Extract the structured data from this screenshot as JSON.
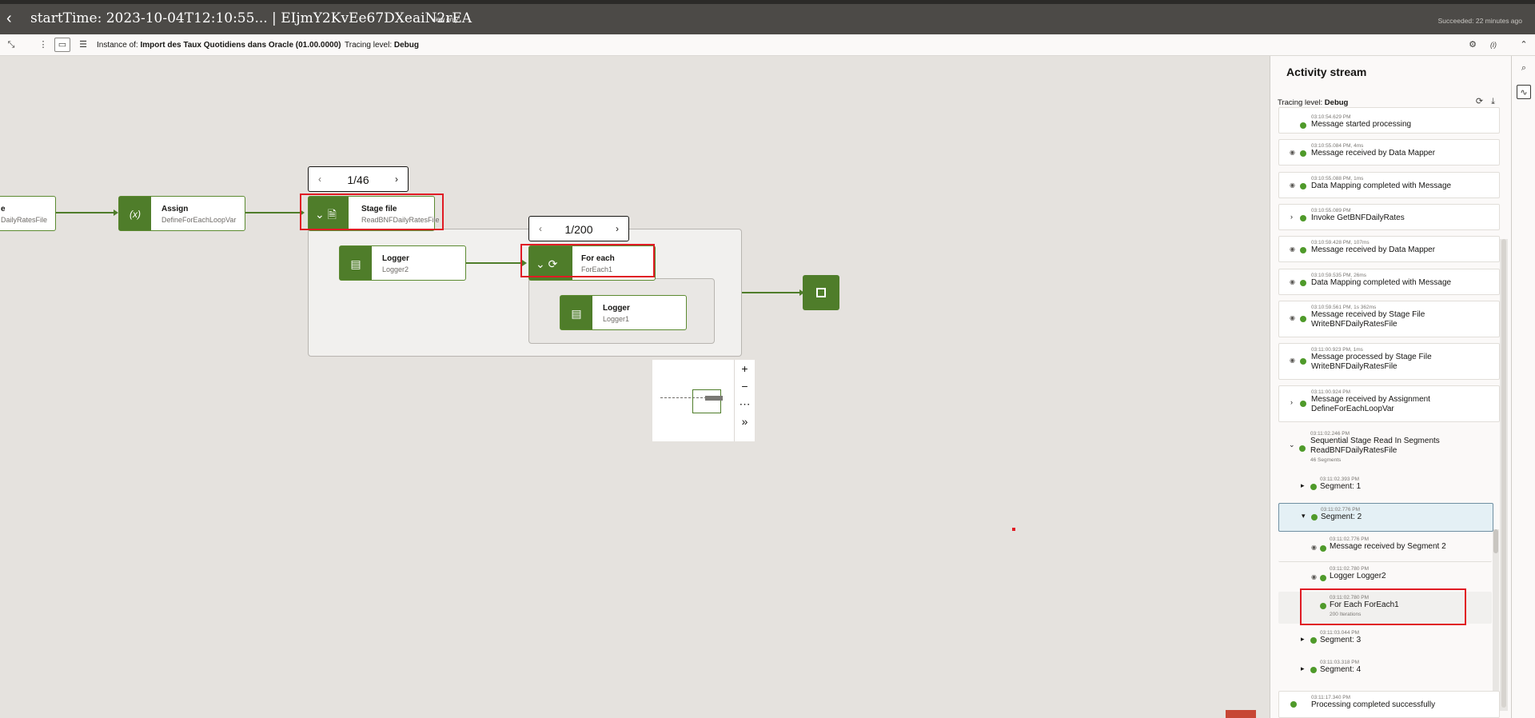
{
  "header": {
    "title": "startTime: 2023-10-04T12:10:55... | EIjmY2KvEe67DXeaiN2rEA",
    "view_only": "View only",
    "status": "Succeeded: 22 minutes ago"
  },
  "toolbar": {
    "instance_label": "Instance of:",
    "instance_name": "Import des Taux Quotidiens dans Oracle (01.00.0000)",
    "tracing_label": "Tracing level:",
    "tracing_value": "Debug",
    "help_glyph": "(i)"
  },
  "canvas": {
    "nodes": {
      "partial": {
        "name": "e",
        "sub": "DailyRatesFile"
      },
      "assign": {
        "name": "Assign",
        "sub": "DefineForEachLoopVar",
        "icon_glyph": "(x)"
      },
      "stage": {
        "name": "Stage file",
        "sub": "ReadBNFDailyRatesFile"
      },
      "logger2": {
        "name": "Logger",
        "sub": "Logger2"
      },
      "foreach": {
        "name": "For each",
        "sub": "ForEach1"
      },
      "logger1": {
        "name": "Logger",
        "sub": "Logger1"
      }
    },
    "pager_stage": "1/46",
    "pager_foreach": "1/200",
    "pager_prev": "‹",
    "pager_next": "›"
  },
  "icons": {
    "back": "back-arrow-icon",
    "collapse": "collapse-icon",
    "settings": "gear-icon",
    "search": "search-icon",
    "activity": "activity-icon",
    "refresh": "refresh-icon",
    "download": "download-icon"
  },
  "colors": {
    "accent_green": "#4f7d2a",
    "header_bg": "#4c4a47",
    "highlight_red": "#e01b24",
    "success": "#4f9a2a"
  },
  "activity": {
    "title": "Activity stream",
    "tracing_label": "Tracing level:",
    "tracing_value": "Debug",
    "items": [
      {
        "ts": "03:10:54.629 PM",
        "label": "Message started processing"
      },
      {
        "ts": "03:10:55.084 PM, 4ms",
        "label": "Message received by Data Mapper"
      },
      {
        "ts": "03:10:55.088 PM, 1ms",
        "label": "Data Mapping completed with Message"
      },
      {
        "ts": "03:10:55.089 PM",
        "label": "Invoke GetBNFDailyRates"
      },
      {
        "ts": "03:10:59.428 PM, 107ms",
        "label": "Message received by Data Mapper"
      },
      {
        "ts": "03:10:59.535 PM, 26ms",
        "label": "Data Mapping completed with Message"
      },
      {
        "ts": "03:10:59.561 PM, 1s 362ms",
        "label": "Message received by Stage File",
        "label2": "WriteBNFDailyRatesFile"
      },
      {
        "ts": "03:11:00.923 PM, 1ms",
        "label": "Message processed by Stage File",
        "label2": "WriteBNFDailyRatesFile"
      },
      {
        "ts": "03:11:00.924 PM",
        "label": "Message received by Assignment",
        "label2": "DefineForEachLoopVar"
      },
      {
        "ts": "03:11:02.246 PM",
        "label": "Sequential Stage Read In Segments",
        "label2": "ReadBNFDailyRatesFile",
        "sub": "46 Segments"
      },
      {
        "ts": "03:11:02.393 PM",
        "label": "Segment: 1"
      },
      {
        "ts": "03:11:02.776 PM",
        "label": "Segment: 2"
      },
      {
        "ts": "03:11:02.776 PM",
        "label": "Message received by Segment 2"
      },
      {
        "ts": "03:11:02.780 PM",
        "label": "Logger Logger2"
      },
      {
        "ts": "03:11:02.780 PM",
        "label": "For Each ForEach1",
        "sub": "200 Iterations"
      },
      {
        "ts": "03:11:03.044 PM",
        "label": "Segment: 3"
      },
      {
        "ts": "03:11:03.318 PM",
        "label": "Segment: 4"
      },
      {
        "ts": "03:11:17.340 PM",
        "label": "Processing completed successfully"
      }
    ]
  }
}
